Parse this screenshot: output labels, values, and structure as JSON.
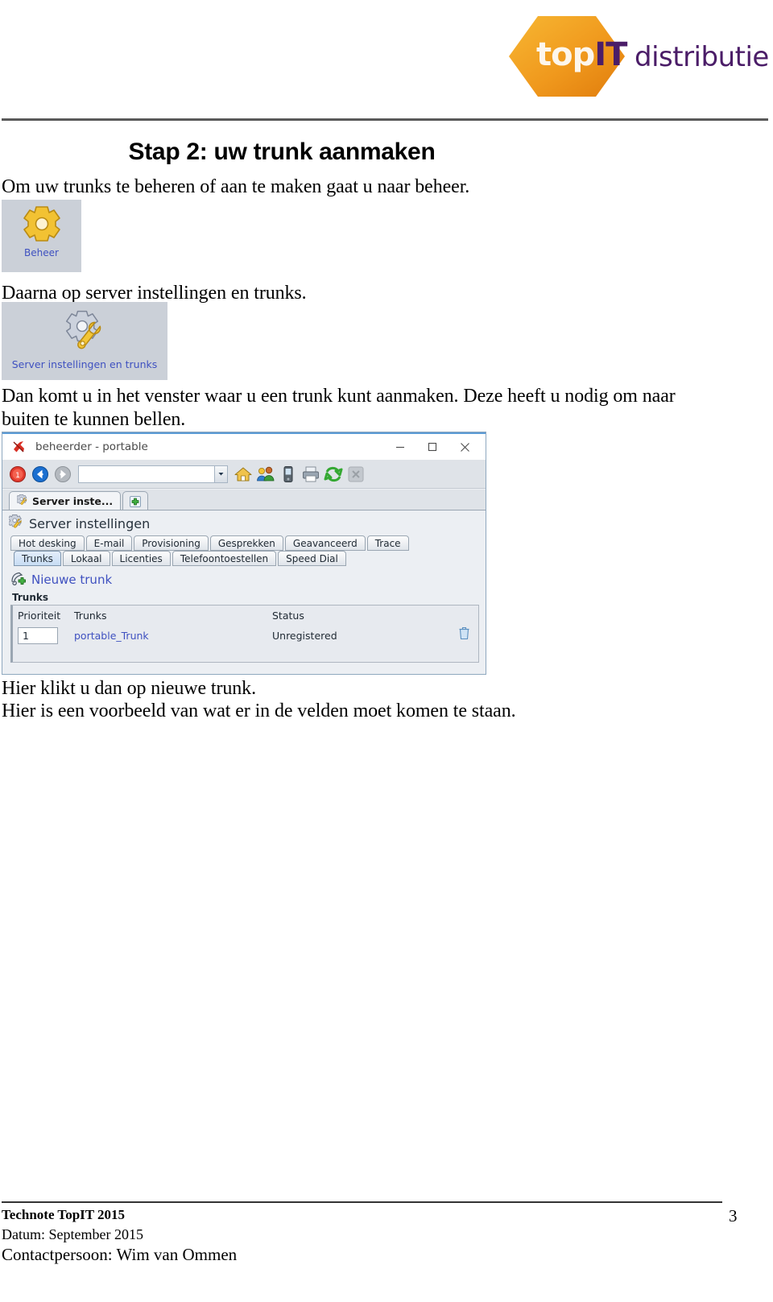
{
  "header": {
    "logo": {
      "word_top": "top",
      "word_it": "IT",
      "tagline": "distributie",
      "hex_color": "#f0a020",
      "purple": "#4b1d68"
    }
  },
  "document": {
    "title": "Stap 2: uw trunk aanmaken",
    "paragraphs": {
      "intro": "Om uw trunks te beheren of aan te maken gaat u naar beheer.",
      "daarna": "Daarna op server instellingen en trunks.",
      "dan": "Dan komt u in het venster waar u een trunk kunt aanmaken. Deze heeft u nodig om naar buiten te kunnen bellen.",
      "hier1": "Hier klikt u dan op nieuwe trunk.",
      "hier2": "Hier is een voorbeeld van wat er in de velden moet komen te staan."
    }
  },
  "tiles": [
    {
      "label": "Beheer",
      "icon": "gear-icon"
    },
    {
      "label": "Server instellingen en trunks",
      "icon": "gear-wrench-icon"
    }
  ],
  "app_window": {
    "title": "beheerder - portable",
    "app_icon": "red-x-icon",
    "controls": {
      "minimize": "—",
      "maximize": "□",
      "close": "✕"
    },
    "toolbar": {
      "icons": [
        "stop-record-icon",
        "back-arrow-icon",
        "forward-arrow-icon",
        "home-icon",
        "users-icon",
        "mobile-phone-icon",
        "printer-icon",
        "refresh-icon",
        "cancel-disabled-icon"
      ],
      "address_value": "",
      "address_placeholder": ""
    },
    "browser_tabs": [
      {
        "label": "Server inste...",
        "icon": "gear-wrench-icon",
        "selected": true
      }
    ],
    "new_tab_label": "+",
    "page": {
      "heading": "Server instellingen",
      "heading_icon": "gear-wrench-icon",
      "tab_rows": [
        [
          {
            "label": "Hot desking",
            "selected": false
          },
          {
            "label": "E-mail",
            "selected": false
          },
          {
            "label": "Provisioning",
            "selected": false
          },
          {
            "label": "Gesprekken",
            "selected": false
          },
          {
            "label": "Geavanceerd",
            "selected": false
          },
          {
            "label": "Trace",
            "selected": false
          }
        ],
        [
          {
            "label": "Trunks",
            "selected": true
          },
          {
            "label": "Lokaal",
            "selected": false
          },
          {
            "label": "Licenties",
            "selected": false
          },
          {
            "label": "Telefoontoestellen",
            "selected": false
          },
          {
            "label": "Speed Dial",
            "selected": false
          }
        ]
      ],
      "new_trunk_link": "Nieuwe trunk",
      "section_label": "Trunks",
      "table": {
        "columns": [
          "Prioriteit",
          "Trunks",
          "Status"
        ],
        "rows": [
          {
            "prioriteit": "1",
            "trunk": "portable_Trunk",
            "status": "Unregistered",
            "delete_icon": "trash-icon"
          }
        ]
      }
    }
  },
  "footer": {
    "line1": "Technote TopIT 2015",
    "line2": "Datum: September 2015",
    "line3": "Contactpersoon: Wim van Ommen",
    "page_number": "3"
  }
}
